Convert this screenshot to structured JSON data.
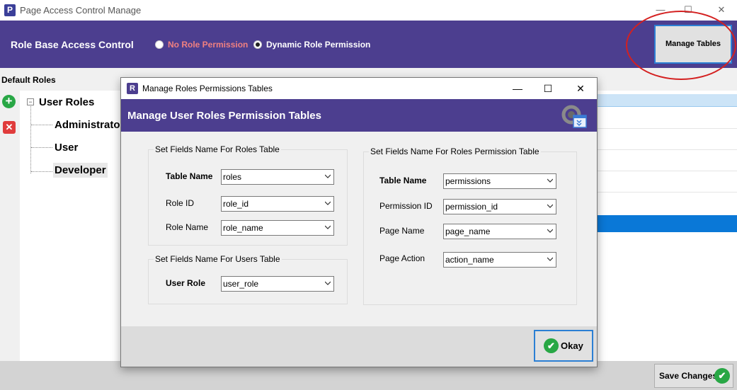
{
  "main_window": {
    "title": "Page Access Control Manage",
    "icon_letter": "P",
    "controls": {
      "minimize": "—",
      "maximize": "☐",
      "close": "✕"
    }
  },
  "header": {
    "title": "Role Base Access Control",
    "radio_no_role": "No Role Permission",
    "radio_dynamic": "Dynamic Role Permission",
    "manage_tables_label": "Manage Tables",
    "colors": {
      "background": "#4c3e8f",
      "no_role_text": "#f08080"
    }
  },
  "left_panel": {
    "title": "Default Roles",
    "tree": {
      "root": "User Roles",
      "children": [
        "Administrator",
        "User",
        "Developer"
      ],
      "selected": "Developer"
    }
  },
  "footer": {
    "save_label": "Save Changes"
  },
  "dialog": {
    "title": "Manage Roles Permissions Tables",
    "icon_letter": "R",
    "header_title": "Manage User Roles Permission Tables",
    "roles_group": {
      "title": "Set Fields Name For Roles Table",
      "fields": [
        {
          "label": "Table Name",
          "value": "roles"
        },
        {
          "label": "Role ID",
          "value": "role_id"
        },
        {
          "label": "Role Name",
          "value": "role_name"
        }
      ]
    },
    "users_group": {
      "title": "Set Fields Name For Users Table",
      "fields": [
        {
          "label": "User Role",
          "value": "user_role"
        }
      ]
    },
    "permissions_group": {
      "title": "Set Fields Name For Roles Permission Table",
      "fields": [
        {
          "label": "Table Name",
          "value": "permissions"
        },
        {
          "label": "Permission ID",
          "value": "permission_id"
        },
        {
          "label": "Page Name",
          "value": "page_name"
        },
        {
          "label": "Page Action",
          "value": "action_name"
        }
      ]
    },
    "okay_label": "Okay",
    "controls": {
      "minimize": "—",
      "maximize": "☐",
      "close": "✕"
    }
  }
}
